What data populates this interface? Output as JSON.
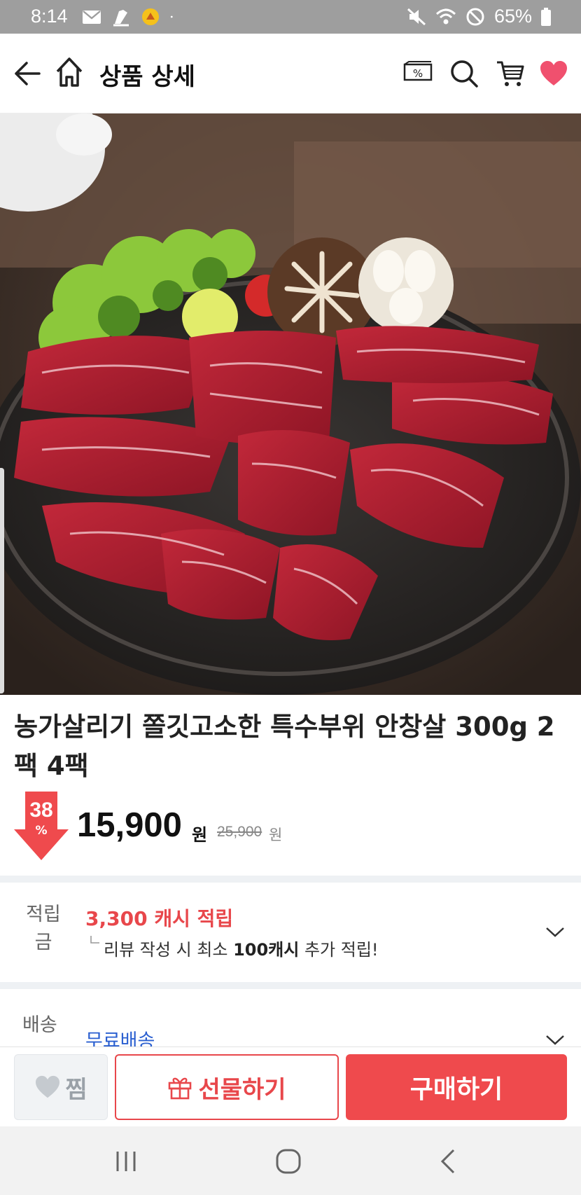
{
  "status_bar": {
    "time": "8:14",
    "battery": "65%",
    "icons": [
      "mail-icon",
      "app-notification-icon",
      "app-badge-icon",
      "dot-icon",
      "mute-icon",
      "wifi-icon",
      "do-not-disturb-icon",
      "battery-icon"
    ]
  },
  "header": {
    "title": "상품 상세",
    "icons": [
      "back-arrow-icon",
      "home-icon",
      "coupon-icon",
      "search-icon",
      "cart-icon",
      "heart-icon"
    ],
    "heart_color": "#f0506e"
  },
  "product": {
    "title": "농가살리기 쫄깃고소한 특수부위 안창살 300g 2팩 4팩",
    "discount_number": "38",
    "discount_percent": "%",
    "price": "15,900",
    "price_unit": "원",
    "original_price": "25,900",
    "original_unit": "원"
  },
  "points": {
    "label": "적립금",
    "main": "3,300 캐시 적립",
    "sub_prefix": "리뷰 작성 시 최소 ",
    "sub_bold": "100캐시",
    "sub_suffix": " 추가 적립!"
  },
  "shipping": {
    "label": "배송",
    "value": "무료배송"
  },
  "actions": {
    "zzim_label": "찜",
    "gift_label": "선물하기",
    "buy_label": "구매하기"
  },
  "colors": {
    "accent": "#ef4a4d",
    "status_bar": "#9e9e9e",
    "link": "#2a5fd0"
  }
}
